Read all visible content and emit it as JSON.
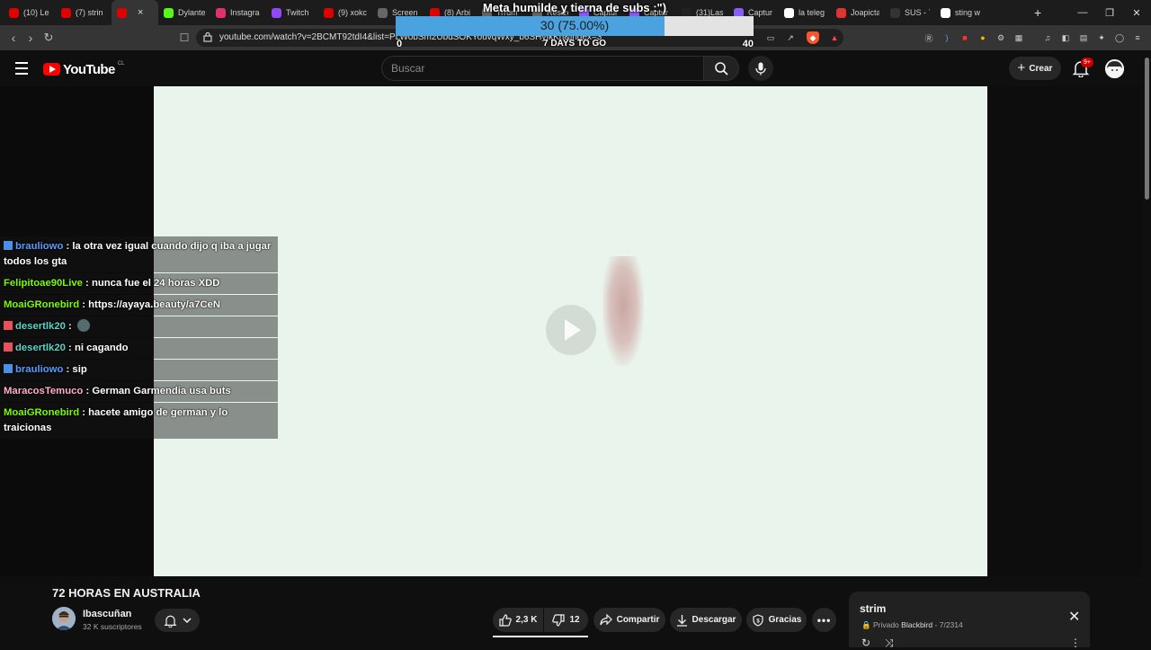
{
  "browser": {
    "tabs": [
      {
        "label": "(10) Le",
        "color": "#e00000"
      },
      {
        "label": "(7) strin",
        "color": "#e00000"
      },
      {
        "label": "",
        "color": "#e00000",
        "active": true
      },
      {
        "label": "Dylante",
        "color": "#53fc18"
      },
      {
        "label": "Instagra",
        "color": "#e1306c"
      },
      {
        "label": "Twitch",
        "color": "#9146ff"
      },
      {
        "label": "(9) xokc",
        "color": "#e00000"
      },
      {
        "label": "Screen",
        "color": "#666"
      },
      {
        "label": "(8) Arbi",
        "color": "#e00000"
      },
      {
        "label": "Trrum",
        "color": "#666"
      },
      {
        "label": "Resize",
        "color": "#666"
      },
      {
        "label": "Captur",
        "color": "#8a5cf5"
      },
      {
        "label": "Captur",
        "color": "#8a5cf5"
      },
      {
        "label": "(31)Las",
        "color": "#222"
      },
      {
        "label": "Captur",
        "color": "#8a5cf5"
      },
      {
        "label": "la teleg",
        "color": "#fff"
      },
      {
        "label": "Joapicta",
        "color": "#d33"
      },
      {
        "label": "SUS - 7",
        "color": "#333"
      },
      {
        "label": "sting w",
        "color": "#fff"
      }
    ],
    "new_tab": "+",
    "url": "youtube.com/watch?v=2BCMT92tdI4&list=PLWobSm2UbdSOKYouvqWxy_b6SHyIkKh&index=3"
  },
  "goal": {
    "title": "Meta humilde y tierna de subs :\")",
    "progress_text": "30 (75.00%)",
    "progress": 0.75,
    "min": "0",
    "max": "40",
    "days": "7 DAYS TO GO",
    "fill_color": "#4aa3df"
  },
  "header": {
    "logo_text": "YouTube",
    "country": "CL",
    "search_placeholder": "Buscar",
    "create_label": "Crear",
    "notifications_badge": "9+"
  },
  "chat": {
    "messages": [
      {
        "user": "brauliowo",
        "text": "la otra vez igual cuando dijo q iba a jugar todos los gta",
        "color": "#5b9cff",
        "badge": "kick"
      },
      {
        "user": "Felipitoae90Live",
        "text": "nunca fue el 24 horas XDD",
        "color": "#7cfc00",
        "badge": ""
      },
      {
        "user": "MoaiGRonebird",
        "text": "https://ayaya.beauty/a7CeN",
        "color": "#7cfc00",
        "badge": ""
      },
      {
        "user": "desertlk20",
        "text": "",
        "color": "#5bd3c7",
        "badge": "heart",
        "emote": true
      },
      {
        "user": "desertlk20",
        "text": "ni cagando",
        "color": "#5bd3c7",
        "badge": "heart"
      },
      {
        "user": "brauliowo",
        "text": "sip",
        "color": "#5b9cff",
        "badge": "kick"
      },
      {
        "user": "MaracosTemuco",
        "text": "German Garmendia usa buts",
        "color": "#ffb0c8",
        "badge": ""
      },
      {
        "user": "MoaiGRonebird",
        "text": "hacete amigo de german y lo traicionas",
        "color": "#7cfc00",
        "badge": ""
      }
    ]
  },
  "video": {
    "title": "72 HORAS EN AUSTRALIA",
    "channel": "Ibascuñan",
    "subscribers": "32 K suscriptores",
    "likes": "2,3 K",
    "dislikes": "12",
    "share_label": "Compartir",
    "download_label": "Descargar",
    "thanks_label": "Gracias"
  },
  "mini_playlist": {
    "title": "strim",
    "privacy": "Privado",
    "owner": "Blackbird",
    "position": "7/2314"
  }
}
